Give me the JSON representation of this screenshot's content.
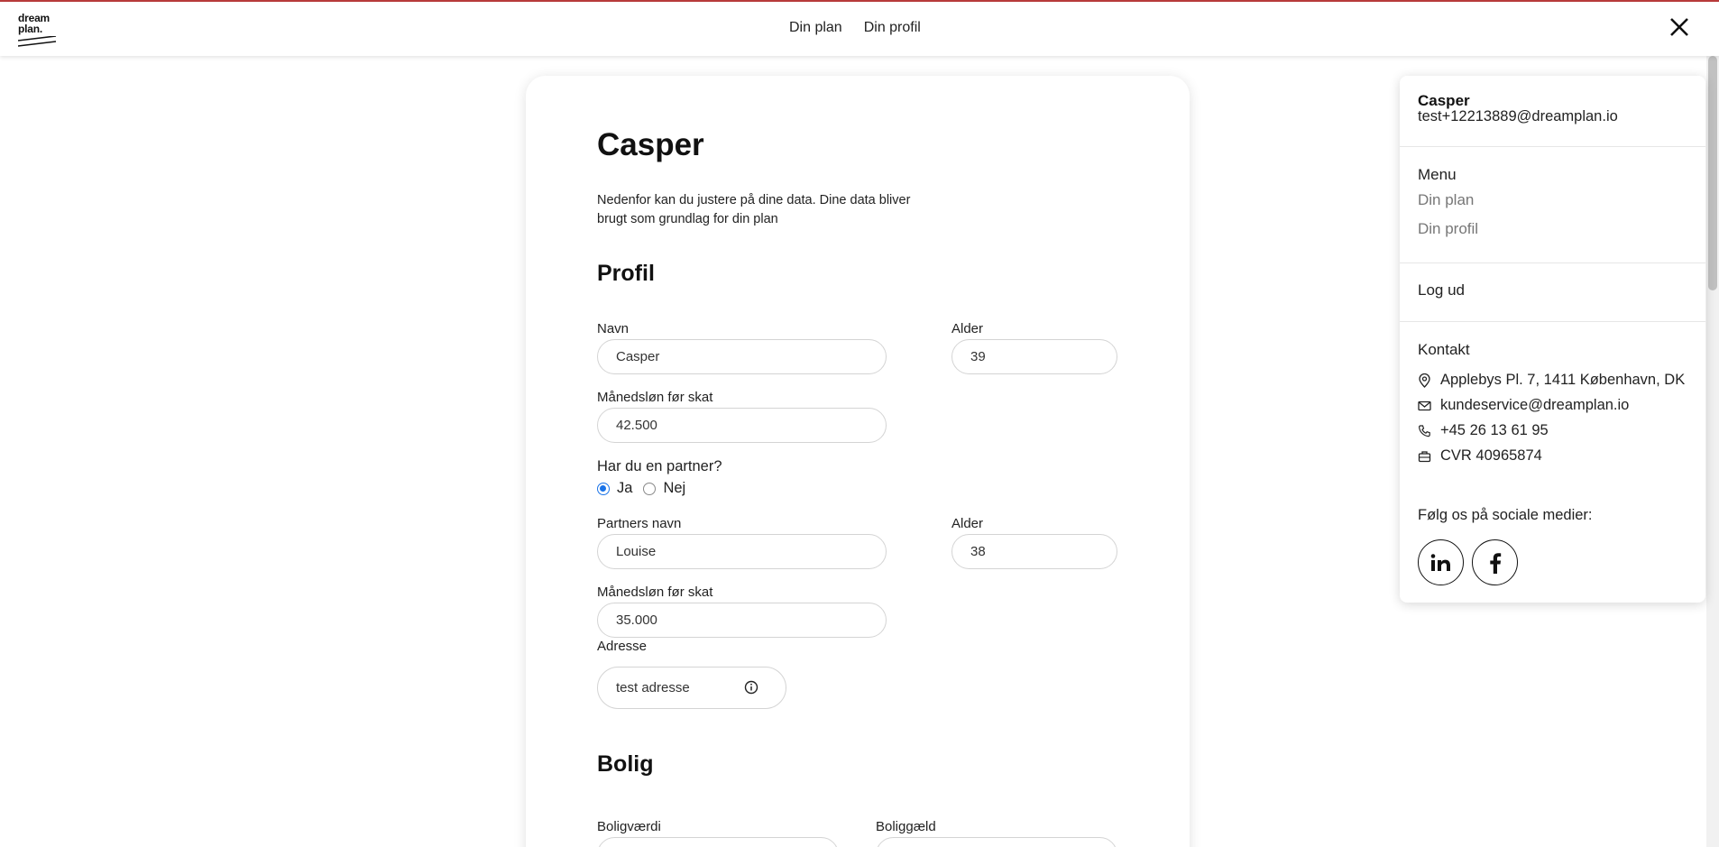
{
  "header": {
    "logo_text_line1": "dream",
    "logo_text_line2": "plan.",
    "nav": [
      "Din plan",
      "Din profil"
    ]
  },
  "profile_card": {
    "title": "Casper",
    "intro": "Nedenfor kan du justere på dine data. Dine data bliver brugt som grundlag for din plan",
    "profil_section": {
      "title": "Profil",
      "name_label": "Navn",
      "name_value": "Casper",
      "age_label": "Alder",
      "age_value": "39",
      "salary_label": "Månedsløn før skat",
      "salary_value": "42.500",
      "partner_question": "Har du en partner?",
      "partner_yes": "Ja",
      "partner_no": "Nej",
      "partner_selected": "Ja",
      "partner_name_label": "Partners navn",
      "partner_name_value": "Louise",
      "partner_age_label": "Alder",
      "partner_age_value": "38",
      "partner_salary_label": "Månedsløn før skat",
      "partner_salary_value": "35.000",
      "address_label": "Adresse",
      "address_value": "test adresse"
    },
    "bolig_section": {
      "title": "Bolig",
      "value_label": "Boligværdi",
      "debt_label": "Boliggæld"
    }
  },
  "side_panel": {
    "user_name": "Casper",
    "user_email": "test+12213889@dreamplan.io",
    "menu_heading": "Menu",
    "menu_items": [
      "Din plan",
      "Din profil"
    ],
    "logout": "Log ud",
    "contact_heading": "Kontakt",
    "contact": {
      "address": "Applebys Pl. 7, 1411 København, DK",
      "email": "kundeservice@dreamplan.io",
      "phone": "+45 26 13 61 95",
      "cvr": "CVR 40965874"
    },
    "social_heading": "Følg os på sociale medier:",
    "social_icons": [
      "linkedin-icon",
      "facebook-icon"
    ]
  },
  "colors": {
    "accent_line": "#b83a3a",
    "radio_selected": "#1a73e8"
  }
}
